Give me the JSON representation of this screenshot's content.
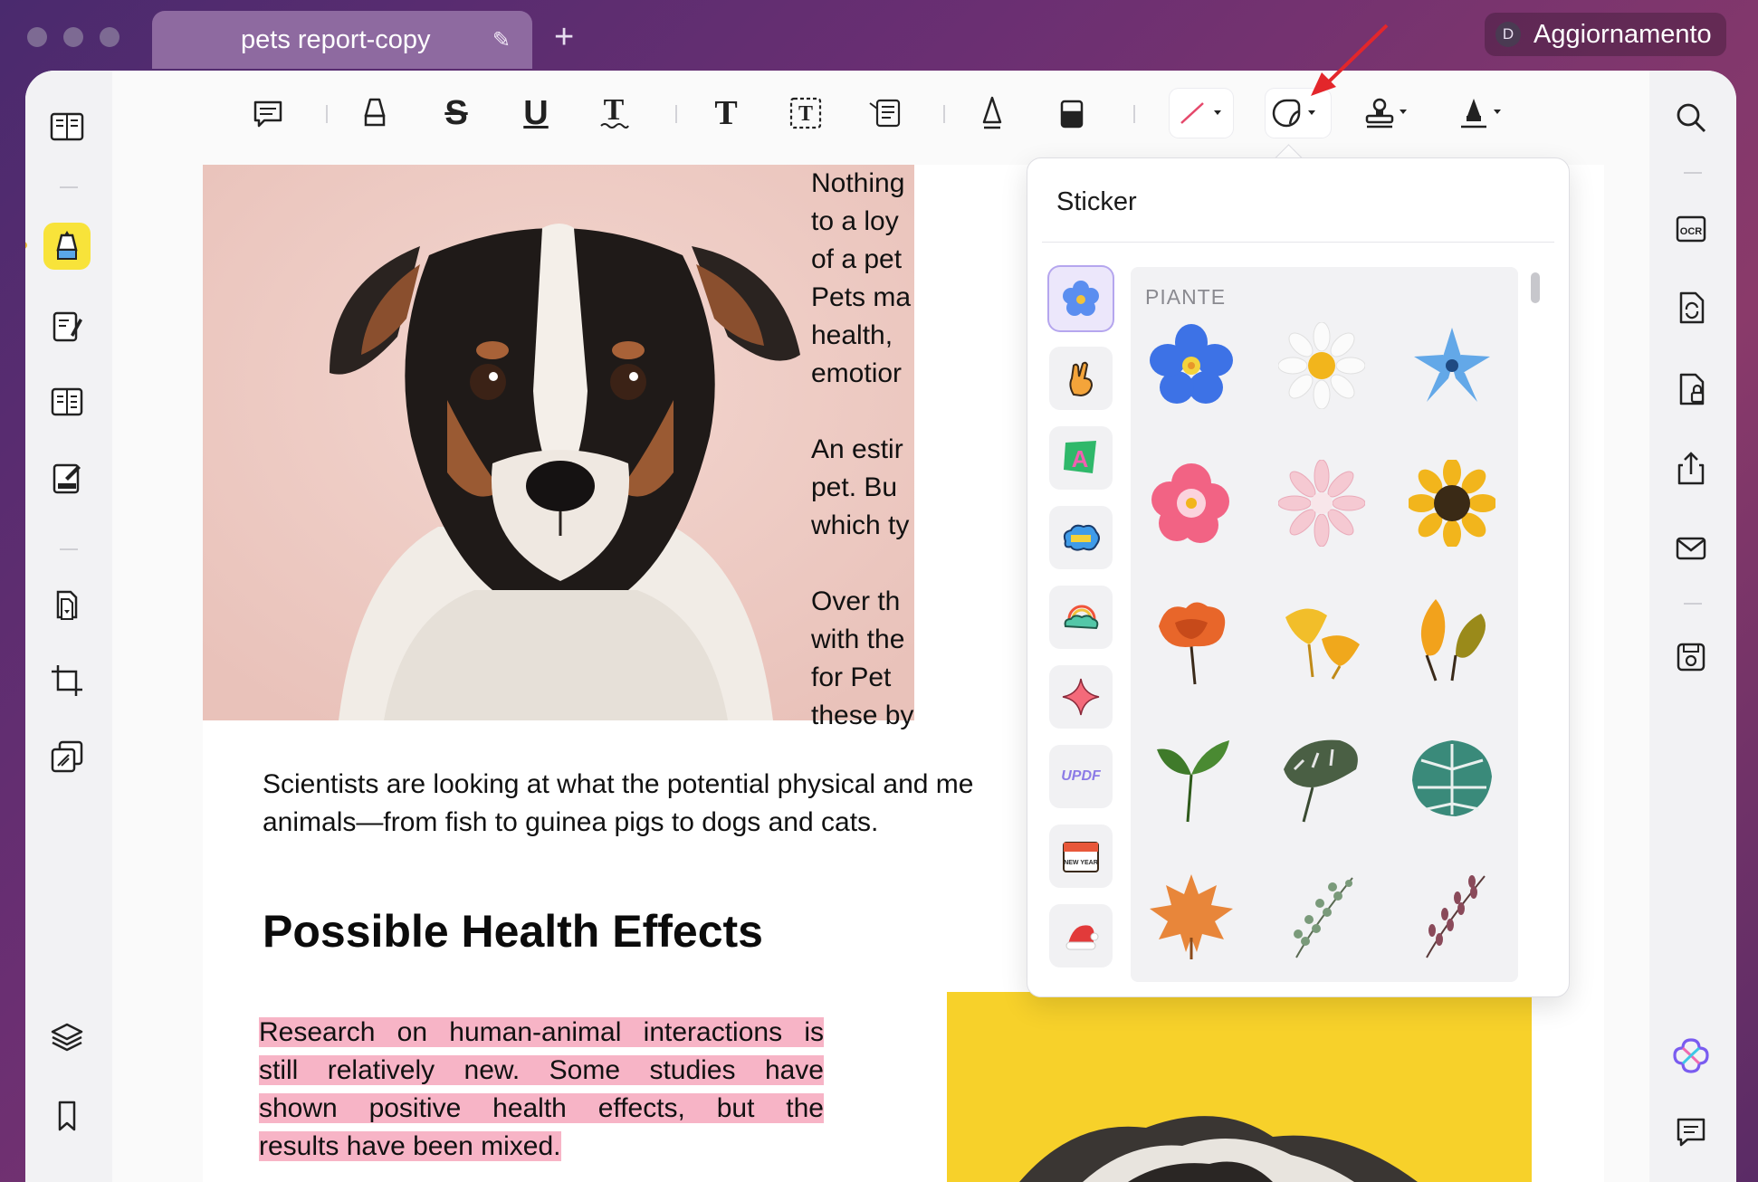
{
  "window": {
    "tab_title": "pets report-copy",
    "update_button_label": "Aggiornamento",
    "avatar_letter": "D"
  },
  "toolbar": {
    "tools": [
      "comment-icon",
      "highlight-icon",
      "strikethrough-icon",
      "underline-icon",
      "squiggly-icon",
      "text-icon",
      "textbox-icon",
      "text-callout-icon",
      "pencil-icon",
      "eraser-icon",
      "shape-line-icon",
      "sticker-icon",
      "stamp-icon",
      "signature-icon"
    ],
    "selected_tool": "sticker-icon"
  },
  "document": {
    "col_lines": [
      "Nothing",
      "to a loy",
      "of a pet",
      "Pets ma",
      "health,",
      "emotior",
      "An estir",
      "pet. Bu",
      "which ty",
      "Over th",
      "with the",
      "for Pet",
      "these by"
    ],
    "paragraph_line1": "Scientists are looking at what the potential physical and me",
    "paragraph_line2": "animals—from fish to guinea pigs to dogs and cats.",
    "heading": "Possible Health Effects",
    "highlighted": [
      "Research on human-animal interactions is",
      "still relatively new. Some studies have",
      "shown positive health effects, but the",
      "results have been mixed."
    ]
  },
  "sticker_panel": {
    "title": "Sticker",
    "category_label": "PIANTE",
    "categories": [
      "flower",
      "hand",
      "letter-a",
      "cloud-badge",
      "rainbow-cloud",
      "sparkle",
      "updf",
      "calendar",
      "santa-hat"
    ],
    "selected_category": "flower",
    "updf_text": "UPDF",
    "calendar_text": "NEW YEAR",
    "stickers": [
      "blue-flower",
      "white-daisy",
      "light-blue-flower",
      "pink-flower",
      "pink-gerbera",
      "sunflower",
      "orange-poppy",
      "ginkgo-leaves",
      "autumn-leaves",
      "green-sprout",
      "monstera-single",
      "monstera-leaf",
      "maple-leaf",
      "eucalyptus-sprig",
      "lavender-sprig"
    ]
  },
  "left_sidebar": {
    "items": [
      "reader-icon",
      "comment-mode-icon",
      "edit-icon",
      "organize-pages-icon",
      "fill-sign-icon",
      "convert-icon",
      "crop-icon",
      "protect-icon",
      "layers-icon",
      "bookmark-icon"
    ]
  },
  "right_sidebar": {
    "items": [
      "search-icon",
      "ocr-icon",
      "convert-file-icon",
      "protect-file-icon",
      "share-icon",
      "email-icon",
      "save-icon",
      "ai-assistant-icon",
      "chat-icon"
    ],
    "ocr_text": "OCR"
  }
}
